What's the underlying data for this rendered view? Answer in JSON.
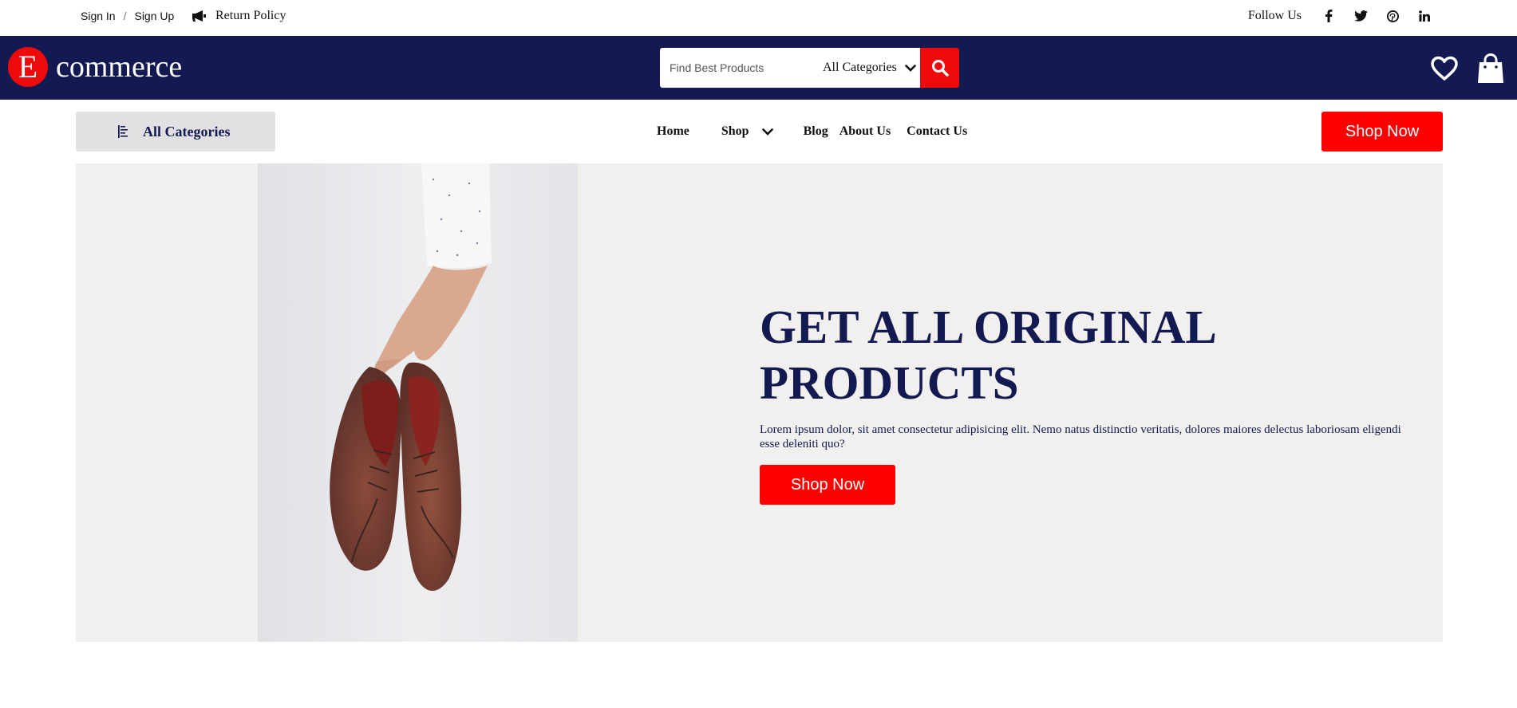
{
  "topbar": {
    "sign_in": "Sign In",
    "separator": "/",
    "sign_up": "Sign Up",
    "return_policy": "Return Policy",
    "follow_us": "Follow Us",
    "social_icons": [
      "facebook-icon",
      "twitter-icon",
      "pinterest-icon",
      "linkedin-icon"
    ]
  },
  "header": {
    "logo_letter": "E",
    "logo_text": "commerce",
    "search": {
      "placeholder": "Find Best Products",
      "category_selected": "All Categories"
    },
    "icons": [
      "heart-icon",
      "shopping-bag-icon"
    ]
  },
  "navbar": {
    "all_categories": "All Categories",
    "links": [
      "Home",
      "Shop",
      "Blog",
      "About Us",
      "Contact Us"
    ],
    "shop_now": "Shop Now"
  },
  "hero": {
    "heading": "GET ALL ORIGINAL PRODUCTS",
    "description": "Lorem ipsum dolor, sit amet consectetur adipisicing elit. Nemo natus distinctio veritatis, dolores maiores delectus laboriosam eligendi esse deleniti quo?",
    "cta": "Shop Now",
    "image_subject": "hand holding brown leather shoes"
  },
  "colors": {
    "navy": "#131a52",
    "red": "#ff0000",
    "hero_bg": "#f1f0ef",
    "category_button_bg": "#e1e0e2"
  }
}
